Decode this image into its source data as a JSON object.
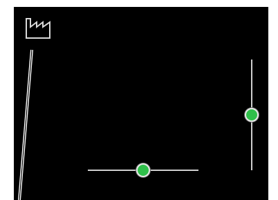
{
  "icons": {
    "top_left": "factory-icon"
  },
  "controls": {
    "horizontal_slider": {
      "value_fraction": 0.5
    },
    "vertical_slider": {
      "value_fraction": 0.5
    }
  },
  "colors": {
    "background": "#000000",
    "track": "#cfcfcf",
    "thumb": "#2fbf4a",
    "thumb_border": "#e8e8e8"
  }
}
